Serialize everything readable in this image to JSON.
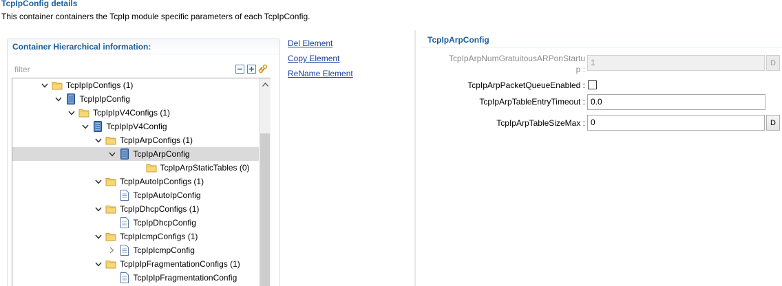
{
  "page": {
    "title": "TcpIpConfig details",
    "description": "This container containers the TcpIp module specific parameters of each TcpIpConfig."
  },
  "left_panel": {
    "title": "Container Hierarchical information:",
    "filter_placeholder": "filter",
    "tree": [
      {
        "label": "TcpIpIpConfigs (1)",
        "icon": "folder-icon",
        "expanded": true
      },
      {
        "label": "TcpIpIpConfig",
        "icon": "container-icon",
        "expanded": true
      },
      {
        "label": "TcpIpIpV4Configs (1)",
        "icon": "folder-icon",
        "expanded": true
      },
      {
        "label": "TcpIpIpV4Config",
        "icon": "container-icon",
        "expanded": true
      },
      {
        "label": "TcpIpArpConfigs (1)",
        "icon": "folder-icon",
        "expanded": true
      },
      {
        "label": "TcpIpArpConfig",
        "icon": "container-icon",
        "expanded": true,
        "selected": true
      },
      {
        "label": "TcpIpArpStaticTables (0)",
        "icon": "folder-icon",
        "expanded": null
      },
      {
        "label": "TcpIpAutoIpConfigs (1)",
        "icon": "folder-icon",
        "expanded": true
      },
      {
        "label": "TcpIpAutoIpConfig",
        "icon": "document-icon",
        "expanded": null
      },
      {
        "label": "TcpIpDhcpConfigs (1)",
        "icon": "folder-icon",
        "expanded": true
      },
      {
        "label": "TcpIpDhcpConfig",
        "icon": "document-icon",
        "expanded": null
      },
      {
        "label": "TcpIpIcmpConfigs (1)",
        "icon": "folder-icon",
        "expanded": true
      },
      {
        "label": "TcpIpIcmpConfig",
        "icon": "document-icon",
        "expanded": false
      },
      {
        "label": "TcpIpIpFragmentationConfigs (1)",
        "icon": "folder-icon",
        "expanded": true
      },
      {
        "label": "TcpIpIpFragmentationConfig",
        "icon": "document-icon",
        "expanded": null
      }
    ]
  },
  "actions": {
    "del": "Del Element",
    "copy": "Copy Element",
    "rename": "ReName Element"
  },
  "right_panel": {
    "title": "TcpIpArpConfig",
    "fields": {
      "gratuitous": {
        "label_line1": "TcpIpArpNumGratuitousARPonStartu",
        "label_line2": "p :",
        "value": "1",
        "button": "D"
      },
      "queue": {
        "label": "TcpIpArpPacketQueueEnabled :"
      },
      "timeout": {
        "label": "TcpIpArpTableEntryTimeout :",
        "value": "0.0"
      },
      "sizemax": {
        "label": "TcpIpArpTableSizeMax :",
        "value": "0",
        "button": "D"
      }
    }
  },
  "colors": {
    "accent": "#1c5e9e",
    "link": "#1a3fa3",
    "selected_row": "#dadada"
  }
}
